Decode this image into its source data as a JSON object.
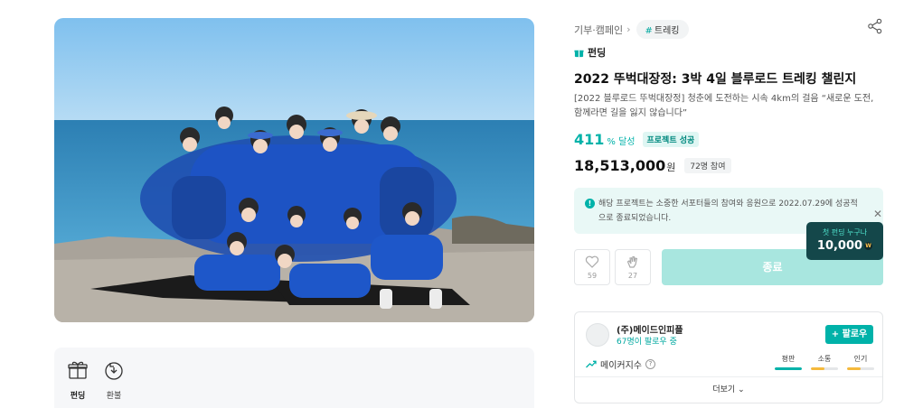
{
  "hero": {
    "image_alt": ""
  },
  "bottom_tabs": [
    {
      "label": "펀딩",
      "icon": "gift-icon",
      "active": true
    },
    {
      "label": "환불",
      "icon": "refund-icon",
      "active": false
    }
  ],
  "breadcrumb": {
    "category": "기부·캠페인",
    "tag": "트레킹"
  },
  "project": {
    "type_label": "펀딩",
    "title": "2022 뚜벅대장정: 3박 4일 블루로드 트레킹 챌린지",
    "description": "[2022 블루로드 뚜벅대장정] 청춘에 도전하는 시속 4km의 걸음 “새로운 도전, 함께라면 길을 잃지 않습니다”",
    "achievement_rate": "411",
    "achievement_unit": "% 달성",
    "success_badge": "프로젝트 성공",
    "amount": "18,513,000",
    "amount_unit": "원",
    "participants": "72명 참여"
  },
  "notice": {
    "text": "해당 프로젝트는 소중한 서포터들의 참여와 응원으로 2022.07.29에 성공적으로 종료되었습니다."
  },
  "first_funding_tip": {
    "label": "첫 펀딩 누구나",
    "amount": "10,000",
    "coin": "W"
  },
  "actions": {
    "like_count": "59",
    "cheer_count": "27",
    "end_label": "종료"
  },
  "maker": {
    "name": "(주)메이드인피플",
    "followers": "67명이 팔로우 중",
    "follow_label": "+ 팔로우",
    "index_label": "메이커지수",
    "metrics": [
      {
        "label": "평판",
        "level": 1.0,
        "color": "#00b2a9"
      },
      {
        "label": "소통",
        "level": 0.5,
        "color": "#f5b93c"
      },
      {
        "label": "인기",
        "level": 0.5,
        "color": "#f5b93c"
      }
    ],
    "more_label": "더보기"
  },
  "colors": {
    "accent": "#00b2a9",
    "accent_light": "#a8e6df",
    "tip_bg": "#14474a"
  }
}
